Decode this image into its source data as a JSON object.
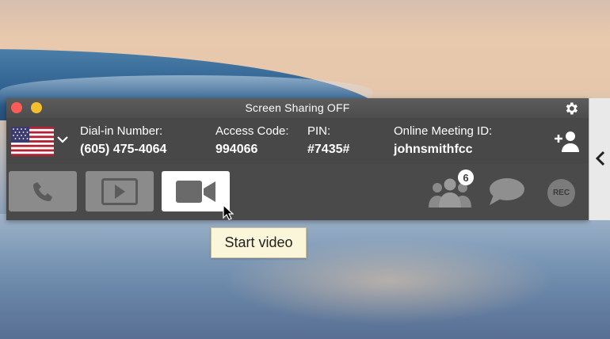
{
  "window": {
    "title": "Screen Sharing OFF",
    "icons": [
      "close-light",
      "minimize-light",
      "gear-icon"
    ]
  },
  "info": {
    "country_flag": "us-flag-icon",
    "dial_in": {
      "label": "Dial-in Number:",
      "value": "(605) 475-4064"
    },
    "access_code": {
      "label": "Access Code:",
      "value": "994066"
    },
    "pin": {
      "label": "PIN:",
      "value": "#7435#"
    },
    "meeting_id": {
      "label": "Online Meeting ID:",
      "value": "johnsmithfcc"
    }
  },
  "controls": {
    "buttons": [
      "phone-icon",
      "play-icon",
      "video-camera-icon"
    ],
    "participant_count": "6",
    "rec_label": "REC"
  },
  "tooltip": {
    "text": "Start video"
  },
  "colors": {
    "toolbar_bg": "#4a4a4a",
    "button_disabled": "#8b8b8b",
    "button_active": "#ffffff",
    "close": "#fc5b57",
    "minimize": "#f5bf2f",
    "tooltip_bg": "#fbf6d9"
  }
}
